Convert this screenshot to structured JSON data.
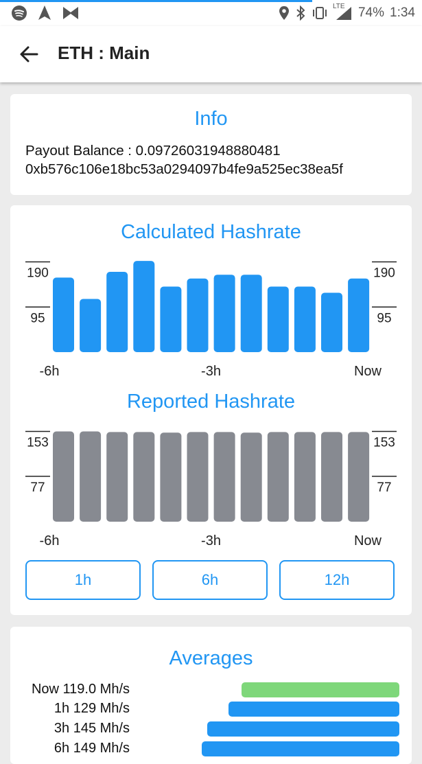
{
  "status_bar": {
    "battery": "74%",
    "time": "1:34",
    "network": "LTE",
    "left_icons": [
      "spotify-icon",
      "navigation-icon",
      "app-icon"
    ],
    "right_icons": [
      "location-icon",
      "bluetooth-icon",
      "vibrate-icon",
      "signal-icon"
    ]
  },
  "app_bar": {
    "title": "ETH : Main"
  },
  "info": {
    "title": "Info",
    "payout_balance": "Payout Balance : 0.09726031948880481",
    "address": "0xb576c106e18bc53a0294097b4fe9a525ec38ea5f"
  },
  "colors": {
    "accent": "#2196f3",
    "reported_bar": "#878a91",
    "now_bar": "#7ed77a"
  },
  "chart_data": [
    {
      "type": "bar",
      "title": "Calculated Hashrate",
      "y_ticks": [
        95,
        190
      ],
      "x_ticks": [
        "-6h",
        "-3h",
        "Now"
      ],
      "values": [
        157,
        112,
        169,
        192,
        138,
        155,
        163,
        163,
        138,
        138,
        125,
        155
      ],
      "color": "#2196f3"
    },
    {
      "type": "bar",
      "title": "Reported Hashrate",
      "y_ticks": [
        77,
        153
      ],
      "x_ticks": [
        "-6h",
        "-3h",
        "Now"
      ],
      "values": [
        153,
        153,
        152,
        152,
        151,
        152,
        152,
        151,
        152,
        152,
        152,
        152
      ],
      "color": "#878a91"
    }
  ],
  "range_buttons": [
    "1h",
    "6h",
    "12h"
  ],
  "averages": {
    "title": "Averages",
    "rows": [
      {
        "label": "Now",
        "value": "119.0 Mh/s",
        "rate": 119.0,
        "color": "#7ed77a"
      },
      {
        "label": "1h",
        "value": "129 Mh/s",
        "rate": 129,
        "color": "#2196f3"
      },
      {
        "label": "3h",
        "value": "145 Mh/s",
        "rate": 145,
        "color": "#2196f3"
      },
      {
        "label": "6h",
        "value": "149 Mh/s",
        "rate": 149,
        "color": "#2196f3"
      }
    ]
  }
}
